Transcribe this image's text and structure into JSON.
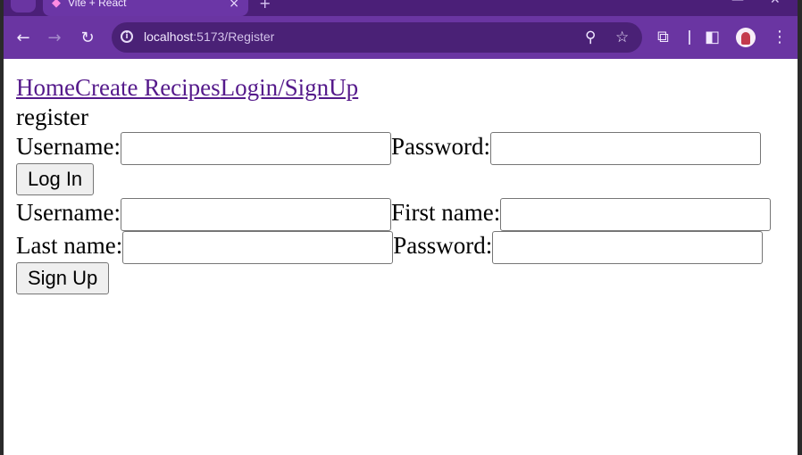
{
  "browser": {
    "tab_title": "Vite + React",
    "tab_close_glyph": "×",
    "new_tab_glyph": "+",
    "minimize_glyph": "—",
    "close_glyph": "✕",
    "url_host": "localhost",
    "url_path": ":5173/Register",
    "back_glyph": "←",
    "forward_glyph": "→",
    "reload_glyph": "↻",
    "zoom_glyph": "⚲",
    "star_glyph": "☆",
    "extensions_glyph": "⧉",
    "sidepanel_glyph": "◧",
    "menu_glyph": "⋮",
    "info_glyph": "i"
  },
  "nav": {
    "home": "Home",
    "create_recipes": "Create Recipes",
    "login_signup": "Login/SignUp"
  },
  "page_heading": "register",
  "login_form": {
    "username_label": "Username:",
    "username_value": "",
    "password_label": "Password:",
    "password_value": "",
    "submit_label": "Log In"
  },
  "signup_form": {
    "username_label": "Username:",
    "username_value": "",
    "first_name_label": "First name:",
    "first_name_value": "",
    "last_name_label": "Last name:",
    "last_name_value": "",
    "password_label": "Password:",
    "password_value": "",
    "submit_label": "Sign Up"
  },
  "colors": {
    "browser_frame": "#5b2a8f",
    "toolbar": "#6a35a2",
    "omnibox": "#4a2176",
    "link": "#551a8b"
  },
  "icons": [
    "back-icon",
    "forward-icon",
    "reload-icon",
    "info-icon",
    "zoom-icon",
    "star-icon",
    "extensions-icon",
    "side-panel-icon",
    "profile-avatar",
    "menu-icon",
    "vite-icon",
    "close-icon"
  ]
}
